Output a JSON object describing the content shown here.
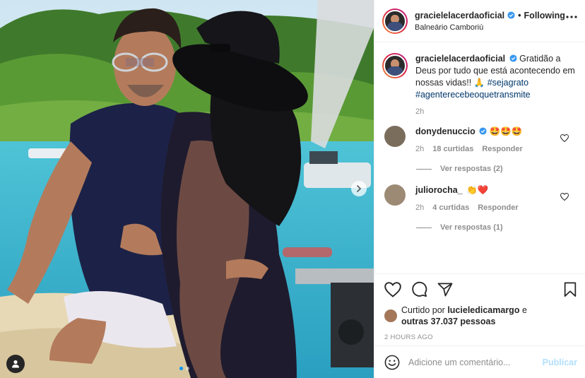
{
  "post": {
    "author": "gracielelacerdaoficial",
    "follow_status": "Following",
    "separator": "•",
    "location": "Balneário Camboriú",
    "more_icon": "more-horizontal-icon"
  },
  "caption": {
    "username": "gracielelacerdaoficial",
    "text": "Gratidão a Deus por tudo que está acontecendo em nossas vidas!! 🙏",
    "hashtags": [
      "#sejagrato",
      "#agenterecebeoquetransmite"
    ],
    "time": "2h"
  },
  "comments": [
    {
      "username": "donydenuccio",
      "text": "🤩🤩🤩",
      "time": "2h",
      "likes": "18 curtidas",
      "reply_label": "Responder",
      "view_replies": "Ver respostas (2)"
    },
    {
      "username": "juliorocha_",
      "text": "👏❤️",
      "time": "2h",
      "likes": "4 curtidas",
      "reply_label": "Responder",
      "view_replies": "Ver respostas (1)"
    }
  ],
  "likes": {
    "prefix": "Curtido por",
    "user": "luciele​dicamargo",
    "conjunction": "e",
    "others": "outras 37.037 pessoas"
  },
  "timestamp": "2 HOURS AGO",
  "add_comment": {
    "placeholder": "Adicione um comentário...",
    "publish_label": "Publicar"
  },
  "carousel": {
    "total": 2,
    "active": 1
  },
  "colors": {
    "verified": "#3897f0",
    "link": "#00376b",
    "muted": "#8e8e8e",
    "publish_disabled": "#b2dffc"
  }
}
